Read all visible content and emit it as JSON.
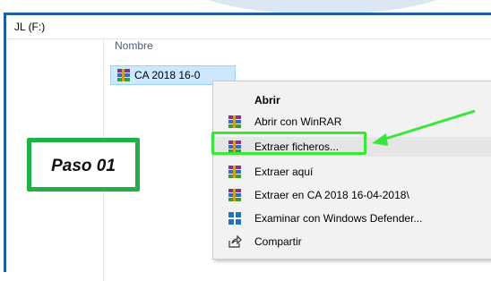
{
  "window": {
    "title": "JL (F:)"
  },
  "list": {
    "column_header": "Nombre",
    "selected_file": {
      "name": "CA 2018 16-0",
      "icon": "winrar-icon"
    }
  },
  "context_menu": {
    "items": [
      {
        "label": "Abrir",
        "icon": "none",
        "bold": true
      },
      {
        "label": "Abrir con WinRAR",
        "icon": "winrar-icon"
      },
      {
        "label": "Extraer ficheros...",
        "icon": "winrar-icon",
        "highlighted": true
      },
      {
        "label": "Extraer aquí",
        "icon": "winrar-icon"
      },
      {
        "label": "Extraer en CA 2018 16-04-2018\\",
        "icon": "winrar-icon"
      },
      {
        "label": "Examinar con Windows Defender...",
        "icon": "windows-defender-icon"
      },
      {
        "label": "Compartir",
        "icon": "share-icon"
      }
    ]
  },
  "annotation": {
    "step_label": "Paso 01",
    "highlight_color": "#39e639",
    "step_border_color": "#1fb146",
    "arrow_color": "#39e639"
  },
  "colors": {
    "window_border": "#1a5fa8",
    "selection": "#cce8ff",
    "menu_bg": "#f2f2f2"
  }
}
